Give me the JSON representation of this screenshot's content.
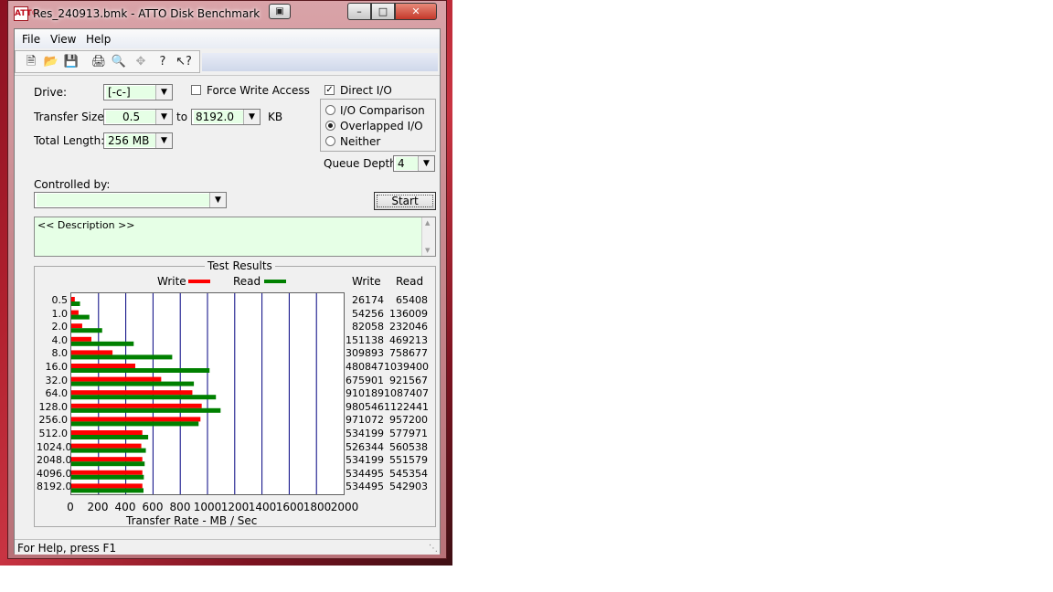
{
  "window": {
    "title": "Res_240913.bmk - ATTO Disk Benchmark",
    "app_icon_text": "ATTO"
  },
  "menu": [
    "File",
    "View",
    "Help"
  ],
  "toolbar": {
    "icons": [
      "new-document-icon",
      "open-folder-icon",
      "save-disk-icon",
      "print-icon",
      "print-preview-icon",
      "move-crosshair-icon",
      "help-question-icon",
      "context-help-icon"
    ]
  },
  "settings": {
    "drive_label": "Drive:",
    "drive_value": "[-c-]",
    "force_write_label": "Force Write Access",
    "force_write_checked": false,
    "transfer_size_label": "Transfer Size:",
    "transfer_from": "0.5",
    "to_label": "to",
    "transfer_to": "8192.0",
    "unit_label": "KB",
    "total_length_label": "Total Length:",
    "total_length_value": "256 MB",
    "direct_io_label": "Direct I/O",
    "direct_io_checked": true,
    "io_options": [
      {
        "label": "I/O Comparison",
        "selected": false
      },
      {
        "label": "Overlapped I/O",
        "selected": true
      },
      {
        "label": "Neither",
        "selected": false
      }
    ],
    "queue_depth_label": "Queue Depth:",
    "queue_depth_value": "4",
    "controlled_by_label": "Controlled by:",
    "controlled_by_value": "",
    "start_label": "Start",
    "description": "<< Description >>"
  },
  "results": {
    "title": "Test Results",
    "write_legend": "Write",
    "read_legend": "Read",
    "write_col": "Write",
    "read_col": "Read",
    "write_color": "#ff0000",
    "read_color": "#008000",
    "rows": [
      {
        "size": "0.5",
        "write": "26174",
        "read": "65408"
      },
      {
        "size": "1.0",
        "write": "54256",
        "read": "136009"
      },
      {
        "size": "2.0",
        "write": "82058",
        "read": "232046"
      },
      {
        "size": "4.0",
        "write": "151138",
        "read": "469213"
      },
      {
        "size": "8.0",
        "write": "309893",
        "read": "758677"
      },
      {
        "size": "16.0",
        "write": "480847",
        "read": "1039400"
      },
      {
        "size": "32.0",
        "write": "675901",
        "read": "921567"
      },
      {
        "size": "64.0",
        "write": "910189",
        "read": "1087407"
      },
      {
        "size": "128.0",
        "write": "980546",
        "read": "1122441"
      },
      {
        "size": "256.0",
        "write": "971072",
        "read": "957200"
      },
      {
        "size": "512.0",
        "write": "534199",
        "read": "577971"
      },
      {
        "size": "1024.0",
        "write": "526344",
        "read": "560538"
      },
      {
        "size": "2048.0",
        "write": "534199",
        "read": "551579"
      },
      {
        "size": "4096.0",
        "write": "534495",
        "read": "545354"
      },
      {
        "size": "8192.0",
        "write": "534495",
        "read": "542903"
      }
    ],
    "x_ticks": [
      "0",
      "200",
      "400",
      "600",
      "800",
      "1000",
      "1200",
      "1400",
      "1600",
      "1800",
      "2000"
    ],
    "x_axis_title": "Transfer Rate - MB / Sec"
  },
  "chart_data": {
    "type": "bar",
    "categories": [
      "0.5",
      "1.0",
      "2.0",
      "4.0",
      "8.0",
      "16.0",
      "32.0",
      "64.0",
      "128.0",
      "256.0",
      "512.0",
      "1024.0",
      "2048.0",
      "4096.0",
      "8192.0"
    ],
    "series": [
      {
        "name": "Write",
        "values": [
          26174,
          54256,
          82058,
          151138,
          309893,
          480847,
          675901,
          910189,
          980546,
          971072,
          534199,
          526344,
          534199,
          534495,
          534495
        ]
      },
      {
        "name": "Read",
        "values": [
          65408,
          136009,
          232046,
          469213,
          758677,
          1039400,
          921567,
          1087407,
          1122441,
          957200,
          577971,
          560538,
          551579,
          545354,
          542903
        ]
      }
    ],
    "orientation": "horizontal",
    "title": "Test Results",
    "xlabel": "Transfer Rate - MB / Sec",
    "ylabel": "",
    "xlim": [
      0,
      2000
    ],
    "grid": true,
    "legend_position": "top"
  },
  "status": {
    "text": "For Help, press F1"
  }
}
